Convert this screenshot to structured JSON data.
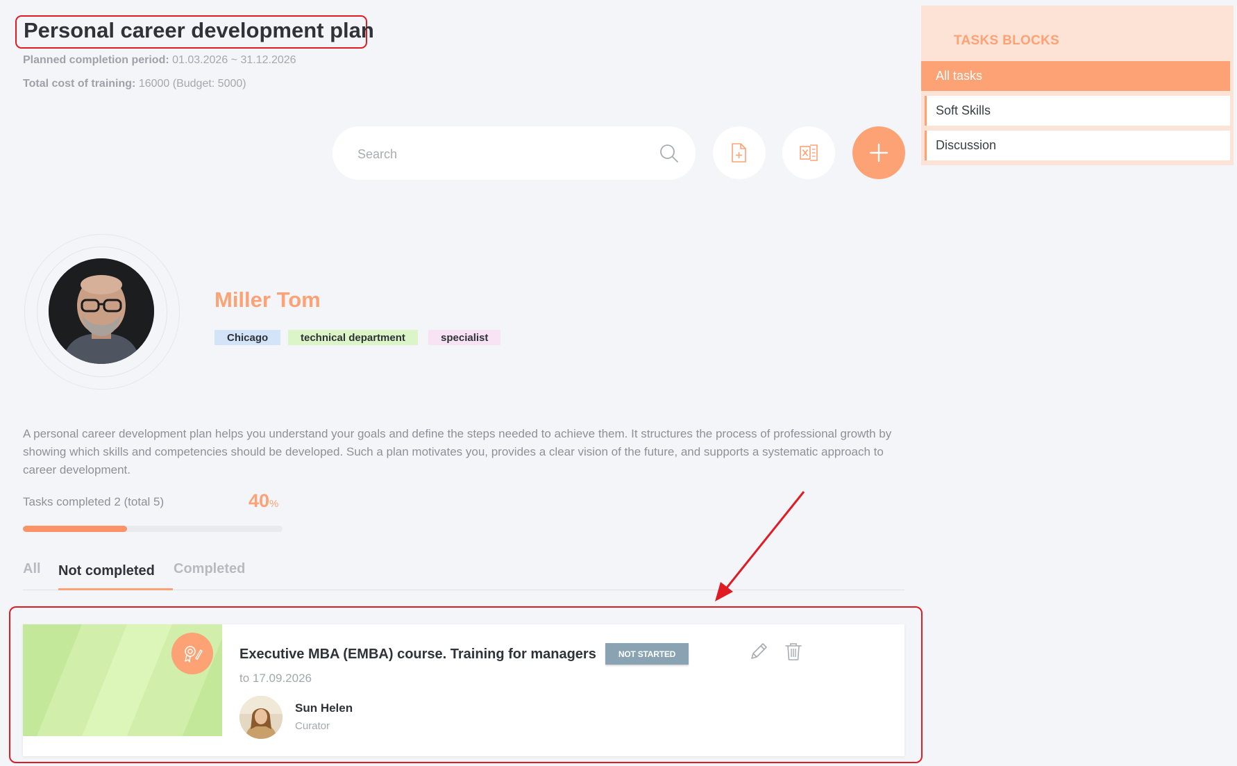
{
  "header": {
    "title": "Personal career development plan",
    "period_label": "Planned completion period:",
    "period_value": "01.03.2026 ~ 31.12.2026",
    "cost_label": "Total cost of training:",
    "cost_value": "16000 (Budget: 5000)"
  },
  "toolbar": {
    "search_placeholder": "Search"
  },
  "sidebar": {
    "title": "TASKS BLOCKS",
    "items": [
      {
        "label": "All tasks"
      },
      {
        "label": "Soft Skills"
      },
      {
        "label": "Discussion"
      }
    ]
  },
  "profile": {
    "name": "Miller Tom",
    "tags": [
      {
        "label": "Chicago",
        "color": "#d3e3f8"
      },
      {
        "label": "technical department",
        "color": "#dcf5c8"
      },
      {
        "label": "specialist",
        "color": "#f8e3f5"
      }
    ]
  },
  "description": "A personal career development plan helps you understand your goals and define the steps needed to achieve them. It structures the process of professional growth by showing which skills and competencies should be developed. Such a plan motivates you, provides a clear vision of the future, and supports a systematic approach to career development.",
  "progress": {
    "label": "Tasks completed 2 (total 5)",
    "value": "40",
    "unit": "%",
    "fraction": 0.4
  },
  "tabs": [
    {
      "label": "All"
    },
    {
      "label": "Not completed"
    },
    {
      "label": "Completed"
    }
  ],
  "task": {
    "title": "Executive MBA (EMBA) course. Training for managers",
    "status": "NOT STARTED",
    "date": "to 17.09.2026",
    "curator_name": "Sun Helen",
    "curator_role": "Curator"
  },
  "colors": {
    "accent": "#fda274",
    "annotation": "#e01b24",
    "status_badge": "#8aa3b3"
  }
}
